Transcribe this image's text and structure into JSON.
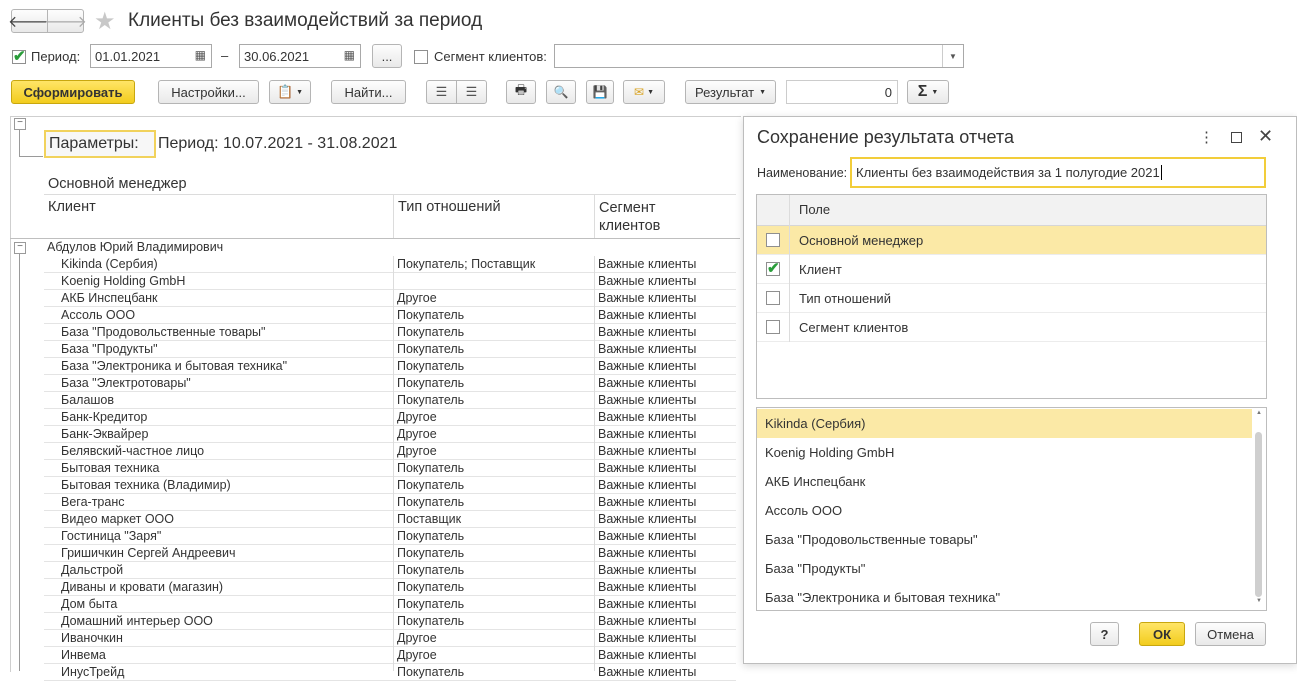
{
  "header": {
    "title": "Клиенты без взаимодействий за период"
  },
  "filters": {
    "period_label": "Период:",
    "period_checked": true,
    "date_from": "01.01.2021",
    "dash": "–",
    "date_to": "30.06.2021",
    "more_label": "...",
    "segment_label": "Сегмент клиентов:",
    "segment_checked": false,
    "segment_value": ""
  },
  "toolbar": {
    "generate": "Сформировать",
    "settings": "Настройки...",
    "find": "Найти...",
    "result": "Результат",
    "sum_value": "0",
    "sum_symbol": "Σ"
  },
  "report": {
    "params_label": "Параметры:",
    "params_value": "Период: 10.07.2021 - 31.08.2021",
    "group_header": "Основной менеджер",
    "columns": [
      "Клиент",
      "Тип отношений",
      "Сегмент",
      "клиентов"
    ],
    "group_name": "Абдулов Юрий Владимирович",
    "rows": [
      {
        "client": "Kikinda (Сербия)",
        "type": "Покупатель; Поставщик",
        "segment": "Важные клиенты"
      },
      {
        "client": "Koenig Holding GmbH",
        "type": "",
        "segment": "Важные клиенты"
      },
      {
        "client": "АКБ Инспецбанк",
        "type": "Другое",
        "segment": "Важные клиенты"
      },
      {
        "client": "Ассоль ООО",
        "type": "Покупатель",
        "segment": "Важные клиенты"
      },
      {
        "client": "База \"Продовольственные товары\"",
        "type": "Покупатель",
        "segment": "Важные клиенты"
      },
      {
        "client": "База \"Продукты\"",
        "type": "Покупатель",
        "segment": "Важные клиенты"
      },
      {
        "client": "База \"Электроника и бытовая техника\"",
        "type": "Покупатель",
        "segment": "Важные клиенты"
      },
      {
        "client": "База \"Электротовары\"",
        "type": "Покупатель",
        "segment": "Важные клиенты"
      },
      {
        "client": "Балашов",
        "type": "Покупатель",
        "segment": "Важные клиенты"
      },
      {
        "client": "Банк-Кредитор",
        "type": "Другое",
        "segment": "Важные клиенты"
      },
      {
        "client": "Банк-Эквайрер",
        "type": "Другое",
        "segment": "Важные клиенты"
      },
      {
        "client": "Белявский-частное лицо",
        "type": "Другое",
        "segment": "Важные клиенты"
      },
      {
        "client": "Бытовая техника",
        "type": "Покупатель",
        "segment": "Важные клиенты"
      },
      {
        "client": "Бытовая техника (Владимир)",
        "type": "Покупатель",
        "segment": "Важные клиенты"
      },
      {
        "client": "Вега-транс",
        "type": "Покупатель",
        "segment": "Важные клиенты"
      },
      {
        "client": "Видео маркет ООО",
        "type": "Поставщик",
        "segment": "Важные клиенты"
      },
      {
        "client": "Гостиница \"Заря\"",
        "type": "Покупатель",
        "segment": "Важные клиенты"
      },
      {
        "client": "Гришичкин Сергей Андреевич",
        "type": "Покупатель",
        "segment": "Важные клиенты"
      },
      {
        "client": "Дальстрой",
        "type": "Покупатель",
        "segment": "Важные клиенты"
      },
      {
        "client": "Диваны и кровати (магазин)",
        "type": "Покупатель",
        "segment": "Важные клиенты"
      },
      {
        "client": "Дом быта",
        "type": "Покупатель",
        "segment": "Важные клиенты"
      },
      {
        "client": "Домашний интерьер ООО",
        "type": "Покупатель",
        "segment": "Важные клиенты"
      },
      {
        "client": "Иваночкин",
        "type": "Другое",
        "segment": "Важные клиенты"
      },
      {
        "client": "Инвема",
        "type": "Другое",
        "segment": "Важные клиенты"
      },
      {
        "client": "ИнусТрейд",
        "type": "Покупатель",
        "segment": "Важные клиенты"
      }
    ]
  },
  "dialog": {
    "title": "Сохранение результата отчета",
    "name_label": "Наименование:",
    "name_value": "Клиенты без взаимодействия за 1 полугодие 2021",
    "fields_header": "Поле",
    "fields": [
      {
        "label": "Основной менеджер",
        "checked": false
      },
      {
        "label": "Клиент",
        "checked": true
      },
      {
        "label": "Тип отношений",
        "checked": false
      },
      {
        "label": "Сегмент клиентов",
        "checked": false
      }
    ],
    "values": [
      "Kikinda (Сербия)",
      "Koenig Holding GmbH",
      "АКБ Инспецбанк",
      "Ассоль ООО",
      "База \"Продовольственные товары\"",
      "База \"Продукты\"",
      "База \"Электроника и бытовая техника\""
    ],
    "help": "?",
    "ok": "ОК",
    "cancel": "Отмена"
  },
  "colors": {
    "accent_yellow": "#f8d82e",
    "selection": "#fbe9a6",
    "check_green": "#2a9d3a"
  }
}
